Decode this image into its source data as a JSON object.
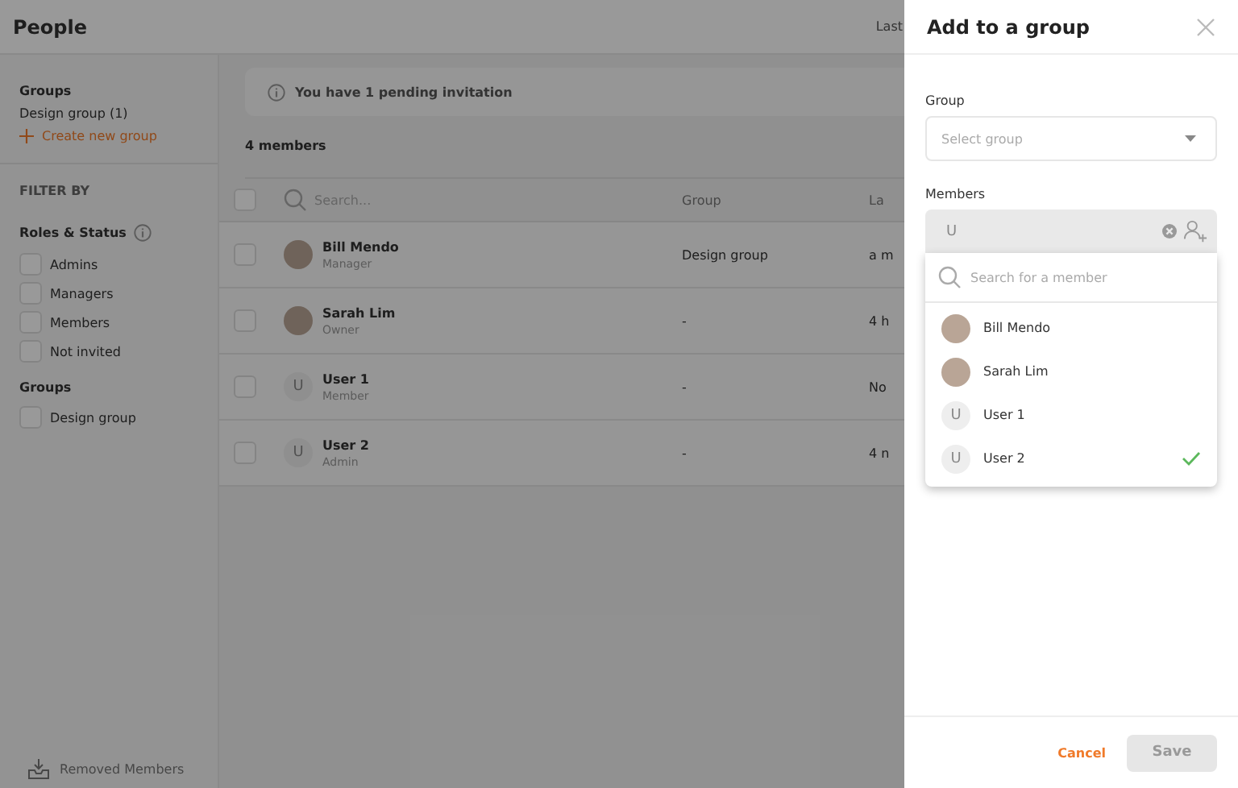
{
  "header": {
    "title": "People",
    "right_text": "Last"
  },
  "sidebar": {
    "groups_heading": "Groups",
    "groups": [
      "Design group (1)"
    ],
    "create_group": "Create new group",
    "filter_heading": "FILTER BY",
    "roles_heading": "Roles & Status",
    "roles": [
      {
        "label": "Admins",
        "checked": false
      },
      {
        "label": "Managers",
        "checked": false
      },
      {
        "label": "Members",
        "checked": false
      },
      {
        "label": "Not invited",
        "checked": false
      }
    ],
    "group_filter_heading": "Groups",
    "group_filters": [
      {
        "label": "Design group",
        "checked": false
      }
    ],
    "removed_members": "Removed Members"
  },
  "banner": "You have 1 pending invitation",
  "member_count": "4 members",
  "table": {
    "search_placeholder": "Search...",
    "columns": [
      "Group",
      "La"
    ],
    "all_checked": false,
    "rows": [
      {
        "kind": "photo",
        "name": "Bill Mendo",
        "role": "Manager",
        "group": "Design group",
        "column_3": "a m",
        "checked": false
      },
      {
        "kind": "photo",
        "name": "Sarah Lim",
        "role": "Owner",
        "group": "-",
        "column_3": "4 h",
        "checked": false
      },
      {
        "kind": "initial",
        "initial": "U",
        "name": "User 1",
        "role": "Member",
        "group": "-",
        "column_3": "No",
        "checked": false
      },
      {
        "kind": "initial",
        "initial": "U",
        "name": "User 2",
        "role": "Admin",
        "group": "-",
        "column_3": "4 n",
        "checked": false
      }
    ]
  },
  "panel": {
    "title": "Add to a group",
    "group_label": "Group",
    "group_placeholder": "Select group",
    "members_label": "Members",
    "members_value": "U",
    "search_placeholder": "Search for a member",
    "options": [
      {
        "kind": "photo",
        "name": "Bill Mendo",
        "selected": false
      },
      {
        "kind": "photo",
        "name": "Sarah Lim",
        "selected": false
      },
      {
        "kind": "initial",
        "initial": "U",
        "name": "User 1",
        "selected": false
      },
      {
        "kind": "initial",
        "initial": "U",
        "name": "User 2",
        "selected": true
      }
    ],
    "cancel": "Cancel",
    "save": "Save"
  }
}
